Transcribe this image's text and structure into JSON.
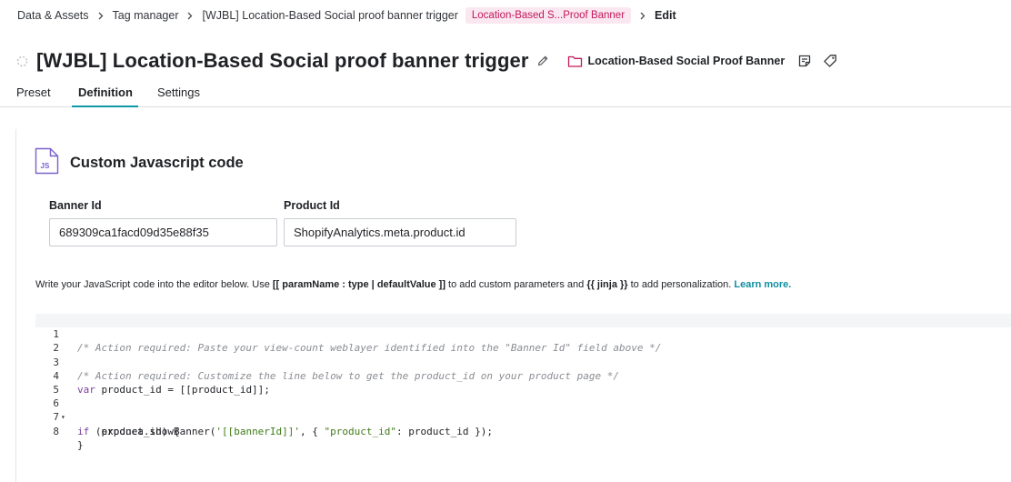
{
  "breadcrumb": {
    "items": [
      "Data & Assets",
      "Tag manager",
      "[WJBL] Location-Based Social proof banner trigger"
    ],
    "folder_pill": "Location-Based S...Proof Banner",
    "current": "Edit"
  },
  "header": {
    "title": "[WJBL] Location-Based Social proof banner trigger",
    "folder": "Location-Based Social Proof Banner"
  },
  "tabs": [
    {
      "label": "Preset",
      "active": false
    },
    {
      "label": "Definition",
      "active": true
    },
    {
      "label": "Settings",
      "active": false
    }
  ],
  "section": {
    "icon_text": "JS",
    "title": "Custom Javascript code"
  },
  "fields": {
    "banner_id": {
      "label": "Banner Id",
      "value": "689309ca1facd09d35e88f35"
    },
    "product_id": {
      "label": "Product Id",
      "value": "ShopifyAnalytics.meta.product.id"
    }
  },
  "help": {
    "prefix": "Write your JavaScript code into the editor below. Use ",
    "param_syntax": "[[ paramName : type | defaultValue ]]",
    "middle": " to add custom parameters and ",
    "jinja_syntax": "{{ jinja }}",
    "suffix": " to add personalization. ",
    "link": "Learn more."
  },
  "editor": {
    "line_numbers": [
      "1",
      "2",
      "3",
      "4",
      "5",
      "6",
      "7",
      "8"
    ],
    "fold_marker": "▾",
    "lines": {
      "l1": "/* Action required: Paste your view-count weblayer identified into the \"Banner Id\" field above */",
      "l3": "/* Action required: Customize the line below to get the product_id on your product page */",
      "l4_kw": "var",
      "l4_rest": " product_id = [[product_id]];",
      "l6_kw": "if",
      "l6_rest": " (product_id) {",
      "l7_a": "    exponea.showBanner(",
      "l7_str1": "'[[bannerId]]'",
      "l7_b": ", { ",
      "l7_str2": "\"product_id\"",
      "l7_c": ": product_id });",
      "l8": "}"
    }
  },
  "colors": {
    "accent": "#0f9aa8",
    "pill_bg": "#fbe7f0",
    "pill_text": "#c2185b",
    "js_icon": "#7b61c9"
  }
}
